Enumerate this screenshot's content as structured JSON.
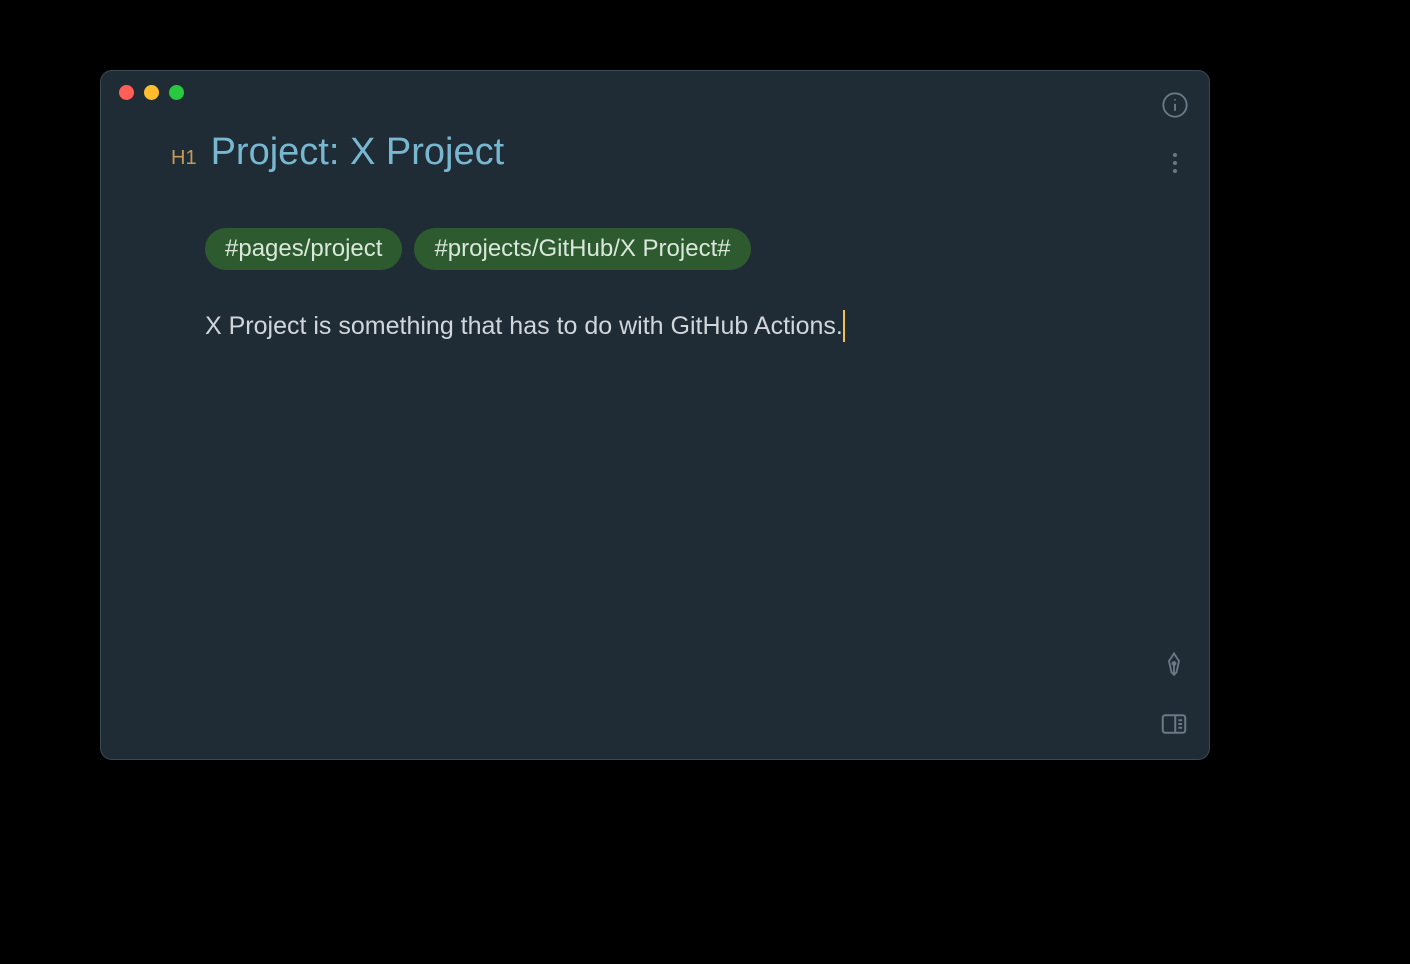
{
  "heading": {
    "marker": "H1",
    "text": "Project: X Project"
  },
  "tags": [
    "#pages/project",
    "#projects/GitHub/X Project#"
  ],
  "body": "X Project is something that has to do with GitHub Actions."
}
